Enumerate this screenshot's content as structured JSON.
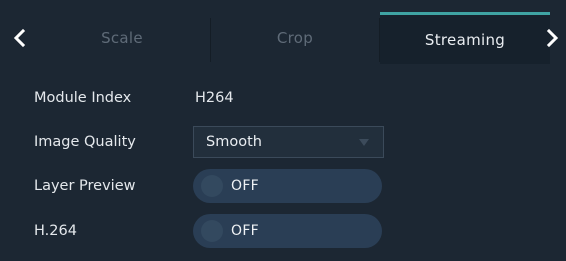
{
  "tabs": [
    {
      "label": "Scale",
      "active": false
    },
    {
      "label": "Crop",
      "active": false
    },
    {
      "label": "Streaming",
      "active": true
    }
  ],
  "nav": {
    "prev_icon": "chevron-left-icon",
    "next_icon": "chevron-right-icon"
  },
  "fields": {
    "module_index": {
      "label": "Module Index",
      "value": "H264"
    },
    "image_quality": {
      "label": "Image Quality",
      "value": "Smooth",
      "icon": "dropdown-caret-icon"
    },
    "layer_preview": {
      "label": "Layer Preview",
      "state": "OFF"
    },
    "h264": {
      "label": "H.264",
      "state": "OFF"
    }
  },
  "colors": {
    "background": "#1c2733",
    "active_tab": "#16212c",
    "accent": "#3fa3a3",
    "toggle_track": "#2a3e55",
    "text": "#e4e8ec",
    "inactive_text": "#5f6b78"
  }
}
